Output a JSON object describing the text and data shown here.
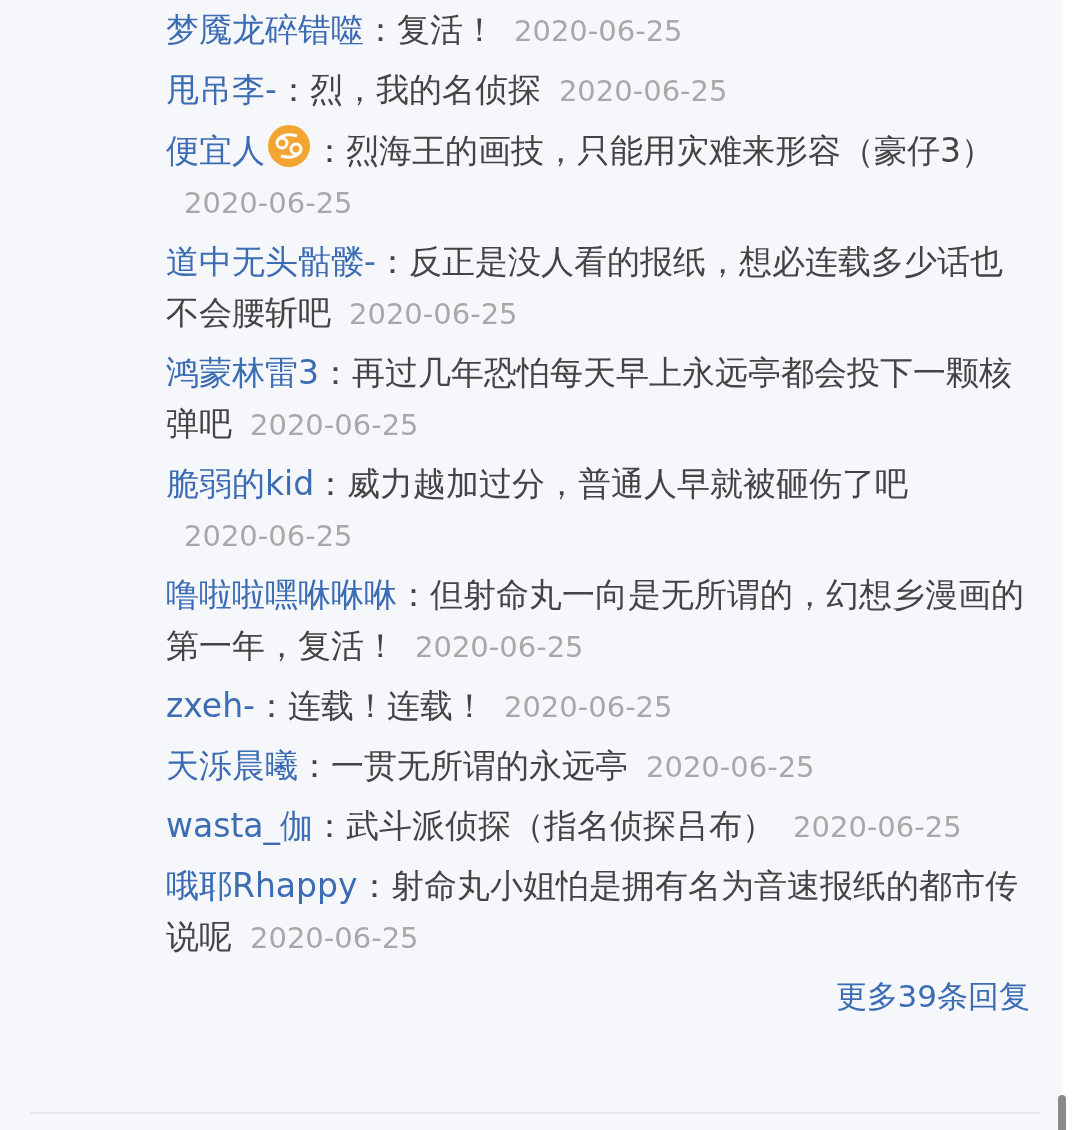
{
  "comments": [
    {
      "name": "梦魇龙碎错噬",
      "badge": false,
      "text": "：复活！",
      "date": "2020-06-25"
    },
    {
      "name": "甩吊李-",
      "badge": false,
      "text": "：烈，我的名侦探",
      "date": "2020-06-25"
    },
    {
      "name": "便宜人",
      "badge": true,
      "text": "：烈海王的画技，只能用灾难来形容（豪仔3）",
      "date": "2020-06-25"
    },
    {
      "name": "道中无头骷髅-",
      "badge": false,
      "text": "：反正是没人看的报纸，想必连载多少话也不会腰斩吧",
      "date": "2020-06-25"
    },
    {
      "name": "鸿蒙林雷3",
      "badge": false,
      "text": "：再过几年恐怕每天早上永远亭都会投下一颗核弹吧",
      "date": "2020-06-25"
    },
    {
      "name": "脆弱的kid",
      "badge": false,
      "text": "：威力越加过分，普通人早就被砸伤了吧",
      "date": "2020-06-25"
    },
    {
      "name": "噜啦啦嘿咻咻咻",
      "badge": false,
      "text": "：但射命丸一向是无所谓的，幻想乡漫画的第一年，复活！",
      "date": "2020-06-25"
    },
    {
      "name": "zxeh-",
      "badge": false,
      "text": "：连载！连载！",
      "date": "2020-06-25"
    },
    {
      "name": "天泺晨曦",
      "badge": false,
      "text": "：一贯无所谓的永远亭",
      "date": "2020-06-25"
    },
    {
      "name": "wasta_伽",
      "badge": false,
      "text": "：武斗派侦探（指名侦探吕布）",
      "date": "2020-06-25"
    },
    {
      "name": "哦耶Rhappy",
      "badge": false,
      "text": "：射命丸小姐怕是拥有名为音速报纸的都市传说呢",
      "date": "2020-06-25"
    }
  ],
  "more_replies": "更多39条回复"
}
